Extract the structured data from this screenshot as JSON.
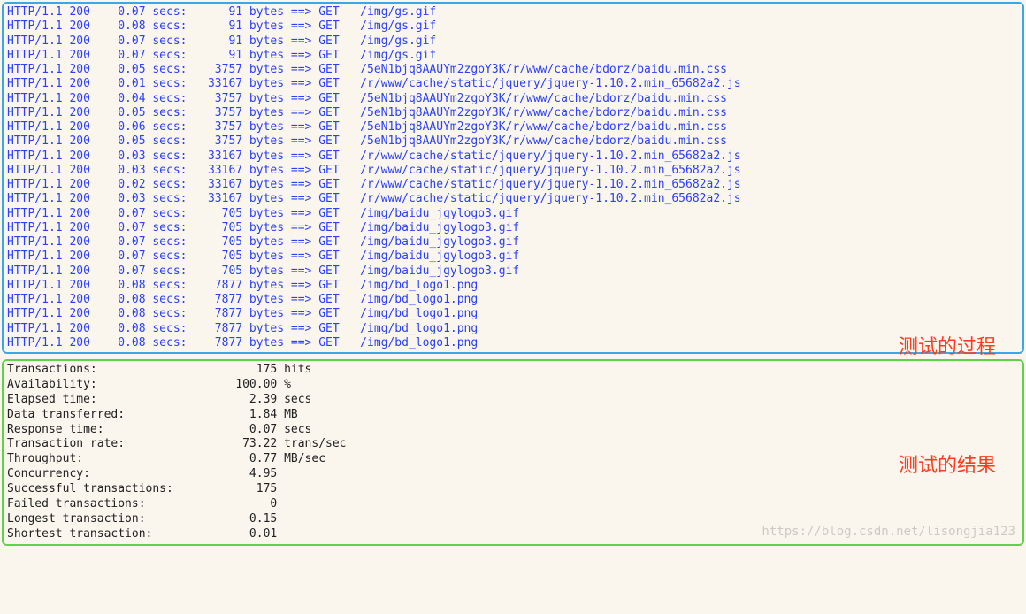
{
  "annotations": {
    "process": "测试的过程",
    "result": "测试的结果"
  },
  "watermark": "https://blog.csdn.net/lisongjia123",
  "log_lines": [
    {
      "proto": "HTTP/1.1",
      "code": "200",
      "secs": "0.07",
      "bytes": "91",
      "method": "GET",
      "path": "/img/gs.gif"
    },
    {
      "proto": "HTTP/1.1",
      "code": "200",
      "secs": "0.08",
      "bytes": "91",
      "method": "GET",
      "path": "/img/gs.gif"
    },
    {
      "proto": "HTTP/1.1",
      "code": "200",
      "secs": "0.07",
      "bytes": "91",
      "method": "GET",
      "path": "/img/gs.gif"
    },
    {
      "proto": "HTTP/1.1",
      "code": "200",
      "secs": "0.07",
      "bytes": "91",
      "method": "GET",
      "path": "/img/gs.gif"
    },
    {
      "proto": "HTTP/1.1",
      "code": "200",
      "secs": "0.05",
      "bytes": "3757",
      "method": "GET",
      "path": "/5eN1bjq8AAUYm2zgoY3K/r/www/cache/bdorz/baidu.min.css"
    },
    {
      "proto": "HTTP/1.1",
      "code": "200",
      "secs": "0.01",
      "bytes": "33167",
      "method": "GET",
      "path": "/r/www/cache/static/jquery/jquery-1.10.2.min_65682a2.js"
    },
    {
      "proto": "HTTP/1.1",
      "code": "200",
      "secs": "0.04",
      "bytes": "3757",
      "method": "GET",
      "path": "/5eN1bjq8AAUYm2zgoY3K/r/www/cache/bdorz/baidu.min.css"
    },
    {
      "proto": "HTTP/1.1",
      "code": "200",
      "secs": "0.05",
      "bytes": "3757",
      "method": "GET",
      "path": "/5eN1bjq8AAUYm2zgoY3K/r/www/cache/bdorz/baidu.min.css"
    },
    {
      "proto": "HTTP/1.1",
      "code": "200",
      "secs": "0.06",
      "bytes": "3757",
      "method": "GET",
      "path": "/5eN1bjq8AAUYm2zgoY3K/r/www/cache/bdorz/baidu.min.css"
    },
    {
      "proto": "HTTP/1.1",
      "code": "200",
      "secs": "0.05",
      "bytes": "3757",
      "method": "GET",
      "path": "/5eN1bjq8AAUYm2zgoY3K/r/www/cache/bdorz/baidu.min.css"
    },
    {
      "proto": "HTTP/1.1",
      "code": "200",
      "secs": "0.03",
      "bytes": "33167",
      "method": "GET",
      "path": "/r/www/cache/static/jquery/jquery-1.10.2.min_65682a2.js"
    },
    {
      "proto": "HTTP/1.1",
      "code": "200",
      "secs": "0.03",
      "bytes": "33167",
      "method": "GET",
      "path": "/r/www/cache/static/jquery/jquery-1.10.2.min_65682a2.js"
    },
    {
      "proto": "HTTP/1.1",
      "code": "200",
      "secs": "0.02",
      "bytes": "33167",
      "method": "GET",
      "path": "/r/www/cache/static/jquery/jquery-1.10.2.min_65682a2.js"
    },
    {
      "proto": "HTTP/1.1",
      "code": "200",
      "secs": "0.03",
      "bytes": "33167",
      "method": "GET",
      "path": "/r/www/cache/static/jquery/jquery-1.10.2.min_65682a2.js"
    },
    {
      "proto": "HTTP/1.1",
      "code": "200",
      "secs": "0.07",
      "bytes": "705",
      "method": "GET",
      "path": "/img/baidu_jgylogo3.gif"
    },
    {
      "proto": "HTTP/1.1",
      "code": "200",
      "secs": "0.07",
      "bytes": "705",
      "method": "GET",
      "path": "/img/baidu_jgylogo3.gif"
    },
    {
      "proto": "HTTP/1.1",
      "code": "200",
      "secs": "0.07",
      "bytes": "705",
      "method": "GET",
      "path": "/img/baidu_jgylogo3.gif"
    },
    {
      "proto": "HTTP/1.1",
      "code": "200",
      "secs": "0.07",
      "bytes": "705",
      "method": "GET",
      "path": "/img/baidu_jgylogo3.gif"
    },
    {
      "proto": "HTTP/1.1",
      "code": "200",
      "secs": "0.07",
      "bytes": "705",
      "method": "GET",
      "path": "/img/baidu_jgylogo3.gif"
    },
    {
      "proto": "HTTP/1.1",
      "code": "200",
      "secs": "0.08",
      "bytes": "7877",
      "method": "GET",
      "path": "/img/bd_logo1.png"
    },
    {
      "proto": "HTTP/1.1",
      "code": "200",
      "secs": "0.08",
      "bytes": "7877",
      "method": "GET",
      "path": "/img/bd_logo1.png"
    },
    {
      "proto": "HTTP/1.1",
      "code": "200",
      "secs": "0.08",
      "bytes": "7877",
      "method": "GET",
      "path": "/img/bd_logo1.png"
    },
    {
      "proto": "HTTP/1.1",
      "code": "200",
      "secs": "0.08",
      "bytes": "7877",
      "method": "GET",
      "path": "/img/bd_logo1.png"
    },
    {
      "proto": "HTTP/1.1",
      "code": "200",
      "secs": "0.08",
      "bytes": "7877",
      "method": "GET",
      "path": "/img/bd_logo1.png"
    }
  ],
  "log_words": {
    "secs": "secs:",
    "bytes": "bytes",
    "arrow": "==>"
  },
  "stats": [
    {
      "label": "Transactions:",
      "value": "175",
      "unit": "hits"
    },
    {
      "label": "Availability:",
      "value": "100.00",
      "unit": "%"
    },
    {
      "label": "Elapsed time:",
      "value": "2.39",
      "unit": "secs"
    },
    {
      "label": "Data transferred:",
      "value": "1.84",
      "unit": "MB"
    },
    {
      "label": "Response time:",
      "value": "0.07",
      "unit": "secs"
    },
    {
      "label": "Transaction rate:",
      "value": "73.22",
      "unit": "trans/sec"
    },
    {
      "label": "Throughput:",
      "value": "0.77",
      "unit": "MB/sec"
    },
    {
      "label": "Concurrency:",
      "value": "4.95",
      "unit": ""
    },
    {
      "label": "Successful transactions:",
      "value": "175",
      "unit": ""
    },
    {
      "label": "Failed transactions:",
      "value": "0",
      "unit": ""
    },
    {
      "label": "Longest transaction:",
      "value": "0.15",
      "unit": ""
    },
    {
      "label": "Shortest transaction:",
      "value": "0.01",
      "unit": ""
    }
  ]
}
